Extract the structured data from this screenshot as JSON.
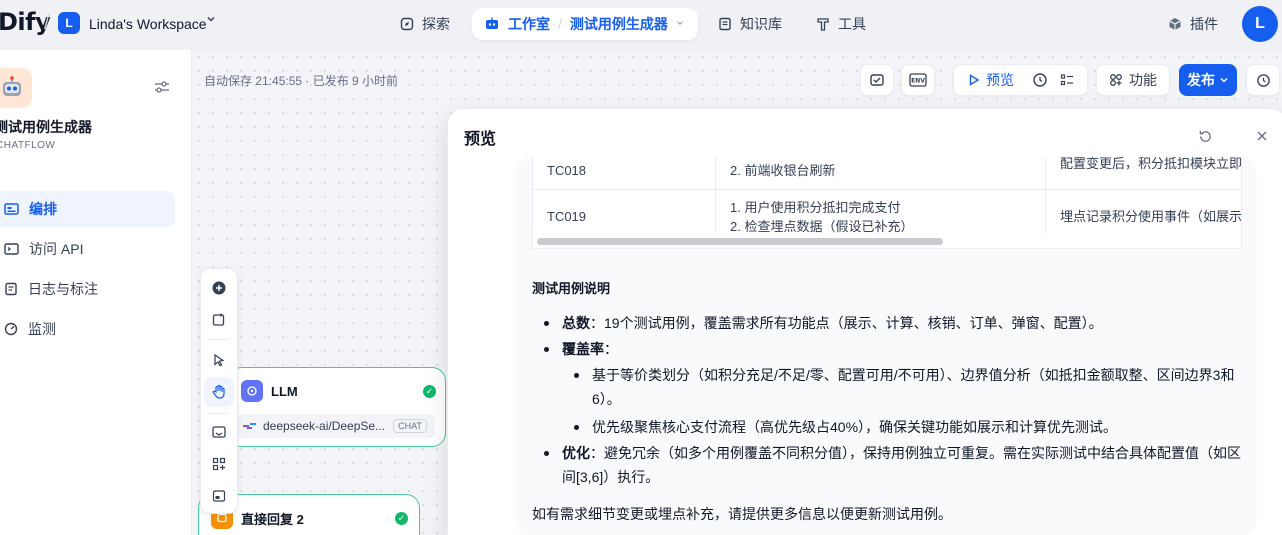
{
  "topbar": {
    "logo": "Dify",
    "workspace_initial": "L",
    "workspace_name": "Linda's Workspace",
    "nav": {
      "explore": "探索",
      "studio": "工作室",
      "app_name": "测试用例生成器",
      "knowledge": "知识库",
      "tools": "工具"
    },
    "plugins": "插件",
    "user_initial": "L"
  },
  "sidebar": {
    "app_title": "测试用例生成器",
    "app_type": "CHATFLOW",
    "items": [
      {
        "label": "编排",
        "icon": "orchestrate-icon",
        "active": true
      },
      {
        "label": "访问 API",
        "icon": "api-icon",
        "active": false
      },
      {
        "label": "日志与标注",
        "icon": "logs-icon",
        "active": false
      },
      {
        "label": "监测",
        "icon": "monitor-icon",
        "active": false
      }
    ]
  },
  "canvas": {
    "autosave": "自动保存 21:45:55 · 已发布 9 小时前",
    "toolbar": {
      "preview": "预览",
      "features": "功能",
      "publish": "发布",
      "env_label": "ENV"
    },
    "nodes": {
      "llm": {
        "title": "LLM",
        "model": "deepseek-ai/DeepSe...",
        "badge": "CHAT"
      },
      "reply": {
        "title": "直接回复 2"
      }
    }
  },
  "preview": {
    "title": "预览",
    "table": {
      "rows": [
        {
          "id": "TC018",
          "steps": [
            "",
            "2. 前端收银台刷新"
          ],
          "expected": "配置变更后，积分抵扣模块立即"
        },
        {
          "id": "TC019",
          "steps": [
            "1. 用户使用积分抵扣完成支付",
            "2. 检查埋点数据（假设已补充）"
          ],
          "expected": "埋点记录积分使用事件（如展示"
        }
      ]
    },
    "md": {
      "heading": "测试用例说明",
      "total_label": "总数",
      "total_text": "：19个测试用例，覆盖需求所有功能点（展示、计算、核销、订单、弹窗、配置）。",
      "coverage_label": "覆盖率",
      "coverage_colon": "：",
      "sub1": "基于等价类划分（如积分充足/不足/零、配置可用/不可用）、边界值分析（如抵扣金额取整、区间边界3和6）。",
      "sub2": "优先级聚焦核心支付流程（高优先级占40%），确保关键功能如展示和计算优先测试。",
      "optimize_label": "优化",
      "optimize_text": "：避免冗余（如多个用例覆盖不同积分值），保持用例独立可重复。需在实际测试中结合具体配置值（如区间[3,6]）执行。",
      "footer": "如有需求细节变更或埋点补充，请提供更多信息以便更新测试用例。"
    }
  },
  "colors": {
    "accent": "#155eef",
    "success": "#12b76a",
    "node_border": "#48c79a"
  }
}
